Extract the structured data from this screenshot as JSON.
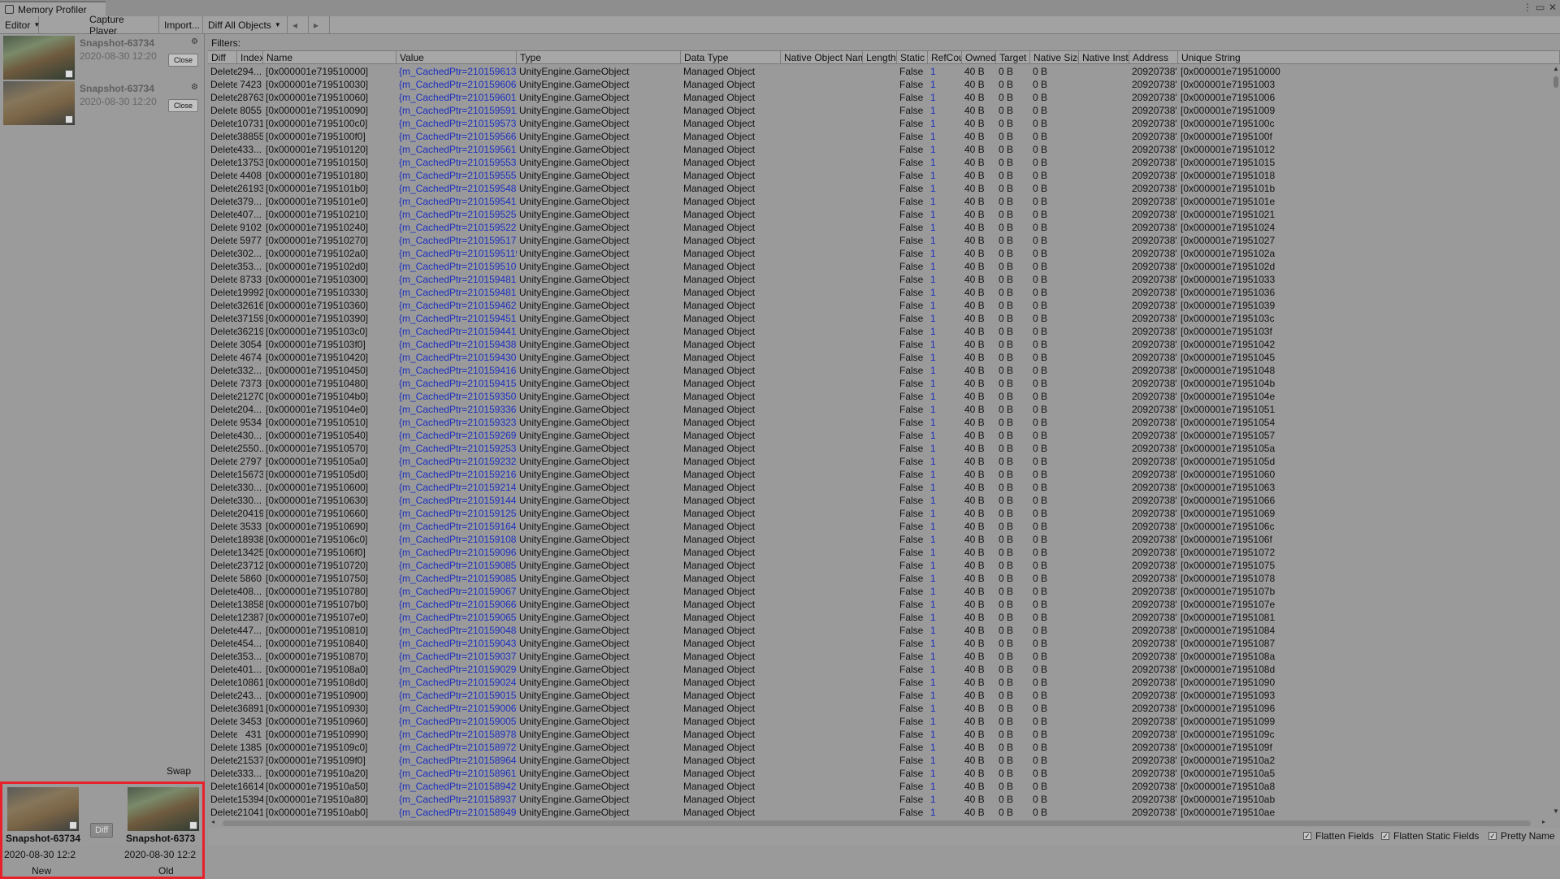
{
  "window": {
    "title": "Memory Profiler"
  },
  "toolbar": {
    "editor": "Editor",
    "capture": "Capture Player",
    "import": "Import...",
    "mode": "Diff All Objects"
  },
  "snapshots": [
    {
      "name": "Snapshot-63734",
      "date": "2020-08-30 12:20",
      "close": "Close"
    },
    {
      "name": "Snapshot-63734",
      "date": "2020-08-30 12:20",
      "close": "Close"
    }
  ],
  "swap": "Swap",
  "diff": {
    "button": "Diff",
    "new": {
      "name": "Snapshot-63734",
      "date": "2020-08-30 12:2",
      "label": "New"
    },
    "old": {
      "name": "Snapshot-6373",
      "date": "2020-08-30 12:2",
      "label": "Old"
    }
  },
  "filters_label": "Filters:",
  "columns": [
    "Diff",
    "Index",
    "Name",
    "Value",
    "Type",
    "Data Type",
    "Native Object Name",
    "Length",
    "Static",
    "RefCou",
    "Owned",
    "Target S",
    "Native Size",
    "Native Insta",
    "Address",
    "Unique String"
  ],
  "row_defaults": {
    "diff": "Deleted",
    "type": "UnityEngine.GameObject",
    "data_type": "Managed Object",
    "static": "False",
    "refcount": "1",
    "owned": "40 B",
    "target": "0 B",
    "native_size": "0 B",
    "address": "20920738'..."
  },
  "rows": [
    {
      "index": "294...",
      "name": "[0x000001e719510000]",
      "value": "{m_CachedPtr=21015961330...",
      "uid": "[0x000001e719510000"
    },
    {
      "index": "7423",
      "name": "[0x000001e719510030]",
      "value": "{m_CachedPtr=210159606918...",
      "uid": "[0x000001e71951003"
    },
    {
      "index": "28763",
      "name": "[0x000001e719510060]",
      "value": "{m_CachedPtr=21015960156...",
      "uid": "[0x000001e71951006"
    },
    {
      "index": "8055",
      "name": "[0x000001e719510090]",
      "value": "{m_CachedPtr=21015959116...",
      "uid": "[0x000001e71951009"
    },
    {
      "index": "10731",
      "name": "[0x000001e7195100c0]",
      "value": "{m_CachedPtr=21015957393...",
      "uid": "[0x000001e7195100c"
    },
    {
      "index": "38855",
      "name": "[0x000001e7195100f0]",
      "value": "{m_CachedPtr=21015956658...",
      "uid": "[0x000001e7195100f"
    },
    {
      "index": "433...",
      "name": "[0x000001e719510120]",
      "value": "{m_CachedPtr=21015956129...",
      "uid": "[0x000001e71951012"
    },
    {
      "index": "13753",
      "name": "[0x000001e719510150]",
      "value": "{m_CachedPtr=21015955397...",
      "uid": "[0x000001e71951015"
    },
    {
      "index": "4408",
      "name": "[0x000001e719510180]",
      "value": "{m_CachedPtr=21015955526...",
      "uid": "[0x000001e71951018"
    },
    {
      "index": "26193",
      "name": "[0x000001e7195101b0]",
      "value": "{m_CachedPtr=21015954850...",
      "uid": "[0x000001e7195101b"
    },
    {
      "index": "379...",
      "name": "[0x000001e7195101e0]",
      "value": "{m_CachedPtr=21015954123...",
      "uid": "[0x000001e7195101e"
    },
    {
      "index": "407...",
      "name": "[0x000001e719510210]",
      "value": "{m_CachedPtr=21015952556...",
      "uid": "[0x000001e71951021"
    },
    {
      "index": "9102",
      "name": "[0x000001e719510240]",
      "value": "{m_CachedPtr=21015952291...",
      "uid": "[0x000001e71951024"
    },
    {
      "index": "5977",
      "name": "[0x000001e719510270]",
      "value": "{m_CachedPtr=21015951756...",
      "uid": "[0x000001e71951027"
    },
    {
      "index": "302...",
      "name": "[0x000001e7195102a0]",
      "value": "{m_CachedPtr=21015951195...",
      "uid": "[0x000001e7195102a"
    },
    {
      "index": "353...",
      "name": "[0x000001e7195102d0]",
      "value": "{m_CachedPtr=21015951069...",
      "uid": "[0x000001e7195102d"
    },
    {
      "index": "8733",
      "name": "[0x000001e719510300]",
      "value": "{m_CachedPtr=21015948185...",
      "uid": "[0x000001e71951033"
    },
    {
      "index": "19992",
      "name": "[0x000001e719510330]",
      "value": "{m_CachedPtr=21015948161...",
      "uid": "[0x000001e71951036"
    },
    {
      "index": "32616",
      "name": "[0x000001e719510360]",
      "value": "{m_CachedPtr=21015946208...",
      "uid": "[0x000001e71951039"
    },
    {
      "index": "37159",
      "name": "[0x000001e719510390]",
      "value": "{m_CachedPtr=21015945181...",
      "uid": "[0x000001e7195103c"
    },
    {
      "index": "36219",
      "name": "[0x000001e7195103c0]",
      "value": "{m_CachedPtr=21015944199...",
      "uid": "[0x000001e7195103f"
    },
    {
      "index": "3054",
      "name": "[0x000001e7195103f0]",
      "value": "{m_CachedPtr=21015943819...",
      "uid": "[0x000001e71951042"
    },
    {
      "index": "4674",
      "name": "[0x000001e719510420]",
      "value": "{m_CachedPtr=21015943019...",
      "uid": "[0x000001e71951045"
    },
    {
      "index": "332...",
      "name": "[0x000001e719510450]",
      "value": "{m_CachedPtr=21015941627...",
      "uid": "[0x000001e71951048"
    },
    {
      "index": "7373",
      "name": "[0x000001e719510480]",
      "value": "{m_CachedPtr=21015941501...",
      "uid": "[0x000001e7195104b"
    },
    {
      "index": "21270",
      "name": "[0x000001e7195104b0]",
      "value": "{m_CachedPtr=21015935032...",
      "uid": "[0x000001e7195104e"
    },
    {
      "index": "204...",
      "name": "[0x000001e7195104e0]",
      "value": "{m_CachedPtr=21015933680...",
      "uid": "[0x000001e71951051"
    },
    {
      "index": "9534",
      "name": "[0x000001e719510510]",
      "value": "{m_CachedPtr=21015932350...",
      "uid": "[0x000001e71951054"
    },
    {
      "index": "430...",
      "name": "[0x000001e719510540]",
      "value": "{m_CachedPtr=21015926930...",
      "uid": "[0x000001e71951057"
    },
    {
      "index": "2550...",
      "name": "[0x000001e719510570]",
      "value": "{m_CachedPtr=21015925356...",
      "uid": "[0x000001e7195105a"
    },
    {
      "index": "2797",
      "name": "[0x000001e7195105a0]",
      "value": "{m_CachedPtr=21015923249...",
      "uid": "[0x000001e7195105d"
    },
    {
      "index": "15673",
      "name": "[0x000001e7195105d0]",
      "value": "{m_CachedPtr=21015921688...",
      "uid": "[0x000001e71951060"
    },
    {
      "index": "330...",
      "name": "[0x000001e719510600]",
      "value": "{m_CachedPtr=21015921435...",
      "uid": "[0x000001e71951063"
    },
    {
      "index": "330...",
      "name": "[0x000001e719510630]",
      "value": "{m_CachedPtr=21015914477...",
      "uid": "[0x000001e71951066"
    },
    {
      "index": "20419",
      "name": "[0x000001e719510660]",
      "value": "{m_CachedPtr=21015912548...",
      "uid": "[0x000001e71951069"
    },
    {
      "index": "3533",
      "name": "[0x000001e719510690]",
      "value": "{m_CachedPtr=21015916433...",
      "uid": "[0x000001e7195106c"
    },
    {
      "index": "18938",
      "name": "[0x000001e7195106c0]",
      "value": "{m_CachedPtr=21015910825...",
      "uid": "[0x000001e7195106f"
    },
    {
      "index": "13425",
      "name": "[0x000001e7195106f0]",
      "value": "{m_CachedPtr=21015909652...",
      "uid": "[0x000001e71951072"
    },
    {
      "index": "23712",
      "name": "[0x000001e719510720]",
      "value": "{m_CachedPtr=21015908587...",
      "uid": "[0x000001e71951075"
    },
    {
      "index": "5860",
      "name": "[0x000001e719510750]",
      "value": "{m_CachedPtr=21015908531...",
      "uid": "[0x000001e71951078"
    },
    {
      "index": "408...",
      "name": "[0x000001e719510780]",
      "value": "{m_CachedPtr=21015906780...",
      "uid": "[0x000001e7195107b"
    },
    {
      "index": "13858",
      "name": "[0x000001e7195107b0]",
      "value": "{m_CachedPtr=21015906641...",
      "uid": "[0x000001e7195107e"
    },
    {
      "index": "12387",
      "name": "[0x000001e7195107e0]",
      "value": "{m_CachedPtr=21015906506...",
      "uid": "[0x000001e71951081"
    },
    {
      "index": "447...",
      "name": "[0x000001e719510810]",
      "value": "{m_CachedPtr=21015904849...",
      "uid": "[0x000001e71951084"
    },
    {
      "index": "454...",
      "name": "[0x000001e719510840]",
      "value": "{m_CachedPtr=21015904388...",
      "uid": "[0x000001e71951087"
    },
    {
      "index": "353...",
      "name": "[0x000001e719510870]",
      "value": "{m_CachedPtr=21015903720...",
      "uid": "[0x000001e7195108a"
    },
    {
      "index": "401...",
      "name": "[0x000001e7195108a0]",
      "value": "{m_CachedPtr=21015902947...",
      "uid": "[0x000001e7195108d"
    },
    {
      "index": "10861",
      "name": "[0x000001e7195108d0]",
      "value": "{m_CachedPtr=21015902414...",
      "uid": "[0x000001e71951090"
    },
    {
      "index": "243...",
      "name": "[0x000001e719510900]",
      "value": "{m_CachedPtr=21015901556...",
      "uid": "[0x000001e71951093"
    },
    {
      "index": "36891",
      "name": "[0x000001e719510930]",
      "value": "{m_CachedPtr=21015900690...",
      "uid": "[0x000001e71951096"
    },
    {
      "index": "3453",
      "name": "[0x000001e719510960]",
      "value": "{m_CachedPtr=21015900538...",
      "uid": "[0x000001e71951099"
    },
    {
      "index": "431",
      "name": "[0x000001e719510990]",
      "value": "{m_CachedPtr=21015897855...",
      "uid": "[0x000001e7195109c"
    },
    {
      "index": "1385",
      "name": "[0x000001e7195109c0]",
      "value": "{m_CachedPtr=21015897292...",
      "uid": "[0x000001e7195109f"
    },
    {
      "index": "21537",
      "name": "[0x000001e7195109f0]",
      "value": "{m_CachedPtr=21015896448...",
      "uid": "[0x000001e719510a2"
    },
    {
      "index": "333...",
      "name": "[0x000001e719510a20]",
      "value": "{m_CachedPtr=21015896139...",
      "uid": "[0x000001e719510a5"
    },
    {
      "index": "16614",
      "name": "[0x000001e719510a50]",
      "value": "{m_CachedPtr=21015894292...",
      "uid": "[0x000001e719510a8"
    },
    {
      "index": "15394",
      "name": "[0x000001e719510a80]",
      "value": "{m_CachedPtr=21015893726...",
      "uid": "[0x000001e719510ab"
    },
    {
      "index": "21041",
      "name": "[0x000001e719510ab0]",
      "value": "{m_CachedPtr=21015894916...",
      "uid": "[0x000001e719510ae"
    }
  ],
  "options": {
    "flatten_fields": "Flatten Fields",
    "flatten_static": "Flatten Static Fields",
    "pretty_name": "Pretty Name"
  }
}
